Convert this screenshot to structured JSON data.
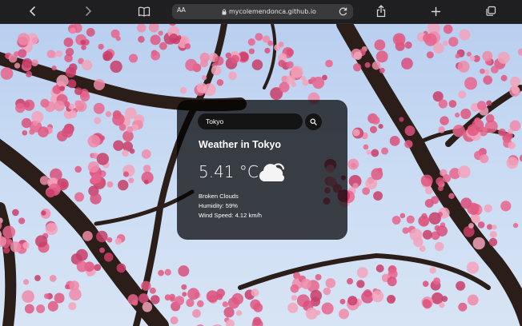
{
  "browser": {
    "address_text": "AA",
    "url": "mycolemendonca.github.io",
    "icons": [
      "back-icon",
      "forward-icon",
      "reader-icon",
      "lock-icon",
      "reload-icon",
      "share-icon",
      "new-tab-icon",
      "tabs-icon"
    ]
  },
  "weather": {
    "search_value": "Tokyo",
    "city_heading": "Weather in Tokyo",
    "temperature": "5.41 °C",
    "description": "Broken Clouds",
    "humidity": "Humidity: 59%",
    "wind": "Wind Speed: 4.12 km/h",
    "icon": "cloud-icon"
  },
  "colors": {
    "card": "#000000",
    "text": "#ffffff",
    "blossom": "#e8648c",
    "branch": "#2b1d18",
    "sky": "#c4d8f2"
  }
}
